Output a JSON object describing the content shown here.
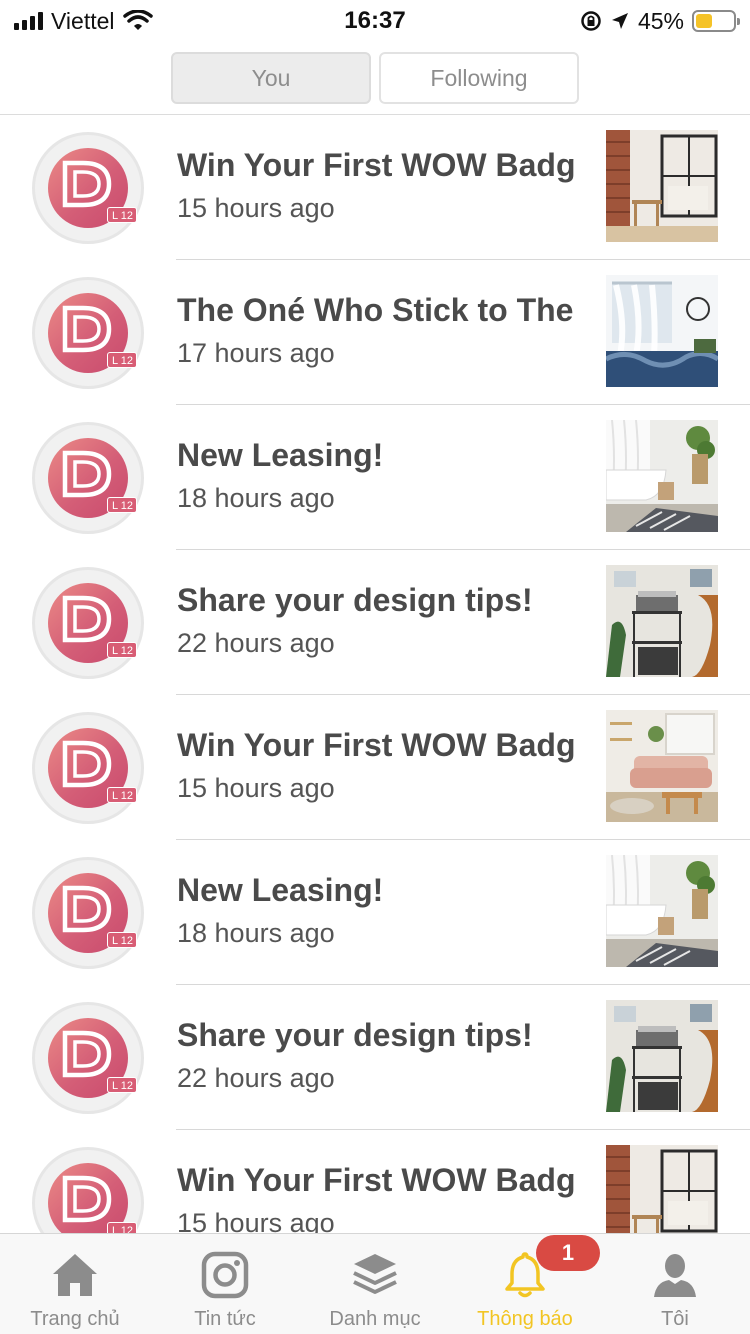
{
  "status_bar": {
    "carrier": "Viettel",
    "time": "16:37",
    "battery_percent_label": "45%",
    "battery_level": 0.45,
    "icons": [
      "signal-icon",
      "wifi-icon",
      "orientation-lock-icon",
      "location-arrow-icon",
      "battery-icon"
    ]
  },
  "segments": {
    "you": "You",
    "following": "Following",
    "selected": "You"
  },
  "notifications": [
    {
      "title": "Win Your First WOW Badge!",
      "time": "15 hours ago",
      "avatar_badge": "L 12",
      "thumb": "brick-loft-room"
    },
    {
      "title": "The Oné Who Stick to The End",
      "time": "17 hours ago",
      "avatar_badge": "L 12",
      "thumb": "canopy-bedroom"
    },
    {
      "title": "New Leasing!",
      "time": "18 hours ago",
      "avatar_badge": "L 12",
      "thumb": "bathtub-rug"
    },
    {
      "title": "Share your design tips!",
      "time": "22 hours ago",
      "avatar_badge": "L 12",
      "thumb": "record-player-shelf"
    },
    {
      "title": "Win Your First WOW Badge!",
      "time": "15 hours ago",
      "avatar_badge": "L 12",
      "thumb": "pink-sofa-living"
    },
    {
      "title": "New Leasing!",
      "time": "18 hours ago",
      "avatar_badge": "L 12",
      "thumb": "bathtub-rug"
    },
    {
      "title": "Share your design tips!",
      "time": "22 hours ago",
      "avatar_badge": "L 12",
      "thumb": "record-player-shelf"
    },
    {
      "title": "Win Your First WOW Badge!",
      "time": "15 hours ago",
      "avatar_badge": "L 12",
      "thumb": "brick-loft-room"
    }
  ],
  "tabbar": {
    "items": [
      {
        "label": "Trang chủ",
        "icon": "home-icon"
      },
      {
        "label": "Tin tức",
        "icon": "instagram-icon"
      },
      {
        "label": "Danh mục",
        "icon": "layers-icon"
      },
      {
        "label": "Thông báo",
        "icon": "bell-icon",
        "badge": "1"
      },
      {
        "label": "Tôi",
        "icon": "user-icon"
      }
    ],
    "active_index": 3
  },
  "colors": {
    "accent": "#f2c523",
    "badge": "#d94a43",
    "avatar": "#d45e77"
  }
}
